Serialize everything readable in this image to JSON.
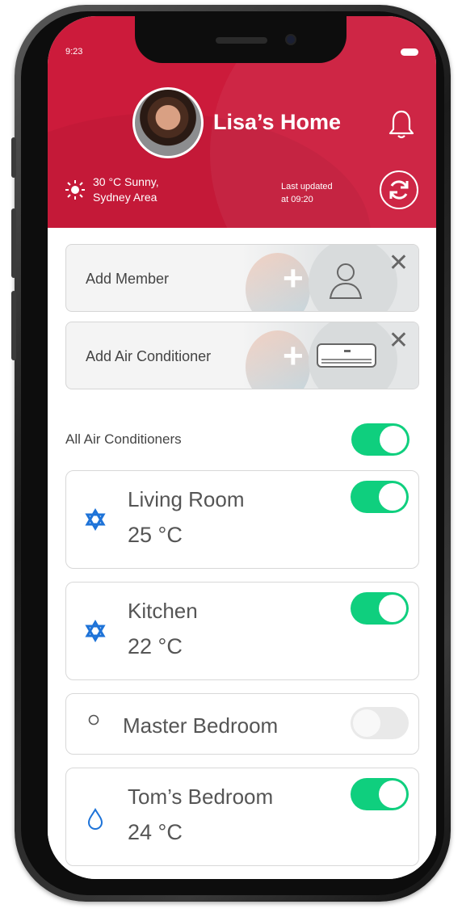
{
  "status": {
    "time": "9:23"
  },
  "header": {
    "title": "Lisa’s Home",
    "weather_line1": "30 °C Sunny,",
    "weather_line2": "Sydney Area",
    "updated_line1": "Last updated",
    "updated_line2": "at 09:20"
  },
  "add_cards": [
    {
      "label": "Add Member",
      "icon": "person-icon"
    },
    {
      "label": "Add Air Conditioner",
      "icon": "air-conditioner-icon"
    }
  ],
  "all_ac": {
    "label": "All Air Conditioners",
    "on": true
  },
  "rooms": [
    {
      "name": "Living Room",
      "temp": "25 °C",
      "mode": "cool",
      "icon": "snowflake-icon",
      "on": true
    },
    {
      "name": "Kitchen",
      "temp": "22 °C",
      "mode": "cool",
      "icon": "snowflake-icon",
      "on": true
    },
    {
      "name": "Master Bedroom",
      "temp": "",
      "mode": "off",
      "icon": "circle-icon",
      "on": false
    },
    {
      "name": "Tom’s Bedroom",
      "temp": "24 °C",
      "mode": "dry",
      "icon": "droplet-icon",
      "on": true
    }
  ],
  "colors": {
    "brand": "#cc1b3b",
    "toggle_on": "#0fcf7e",
    "icon_blue": "#1e73d8"
  }
}
